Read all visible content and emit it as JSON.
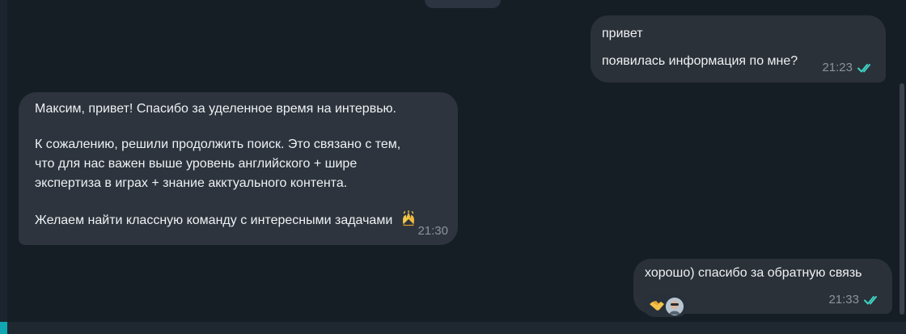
{
  "messages": {
    "top_outgoing": {
      "lines": [
        "привет",
        "",
        "появилась информация по мне?"
      ],
      "time": "21:23",
      "status": "read"
    },
    "incoming": {
      "lines": [
        "Максим, привет! Спасибо за уделенное время на интервью.",
        "",
        "К сожалению, решили продолжить поиск. Это связано с тем,",
        "что для нас важен выше уровень английского + шире",
        "экспертиза в играх + знание акктуального контента.",
        "",
        "Желаем найти классную команду с интересными задачами"
      ],
      "emoji": "raising-hands-emoji",
      "time": "21:30"
    },
    "bottom_outgoing": {
      "text": "хорошо) спасибо за обратную связь",
      "reaction_emoji": "handshake-emoji",
      "reaction_avatar": "user-avatar",
      "time": "21:33",
      "status": "read"
    }
  },
  "colors": {
    "background": "#151d25",
    "bubble_in": "#2d343d",
    "bubble_out": "#2b3138",
    "read_check": "#3dd3c5",
    "accent": "#10a7b3"
  }
}
